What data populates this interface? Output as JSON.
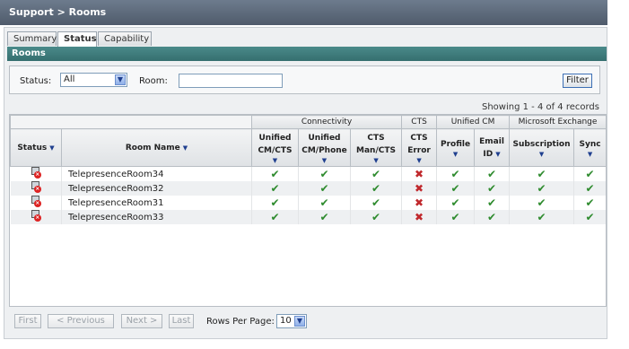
{
  "header": {
    "breadcrumb": "Support > Rooms"
  },
  "tabs": [
    {
      "label": "Summary",
      "active": false
    },
    {
      "label": "Status",
      "active": true
    },
    {
      "label": "Capability",
      "active": false
    }
  ],
  "section": {
    "title": "Rooms"
  },
  "filter": {
    "status_label": "Status:",
    "status_value": "All",
    "room_label": "Room:",
    "room_value": "",
    "button_label": "Filter"
  },
  "summary": {
    "showing": "Showing 1 - 4 of 4 records"
  },
  "table": {
    "groups": {
      "connectivity": "Connectivity",
      "cts": "CTS",
      "unified_cm": "Unified CM",
      "exchange": "Microsoft Exchange"
    },
    "columns": {
      "status": "Status",
      "room_name": "Room Name",
      "cm_cts_1": "Unified",
      "cm_cts_2": "CM/CTS",
      "cm_phone_1": "Unified",
      "cm_phone_2": "CM/Phone",
      "man_cts_1": "CTS",
      "man_cts_2": "Man/CTS",
      "cts_error_1": "CTS",
      "cts_error_2": "Error",
      "profile": "Profile",
      "email_1": "Email",
      "email_2": "ID",
      "subscription": "Subscription",
      "sync": "Sync"
    },
    "rows": [
      {
        "status_icon": "room-error-icon",
        "name": "TelepresenceRoom34",
        "cm_cts": "✔",
        "cm_phone": "✔",
        "man_cts": "✔",
        "cts_error": "✖",
        "profile": "✔",
        "email": "✔",
        "subscription": "✔",
        "sync": "✔"
      },
      {
        "status_icon": "room-error-icon",
        "name": "TelepresenceRoom32",
        "cm_cts": "✔",
        "cm_phone": "✔",
        "man_cts": "✔",
        "cts_error": "✖",
        "profile": "✔",
        "email": "✔",
        "subscription": "✔",
        "sync": "✔"
      },
      {
        "status_icon": "room-error-icon",
        "name": "TelepresenceRoom31",
        "cm_cts": "✔",
        "cm_phone": "✔",
        "man_cts": "✔",
        "cts_error": "✖",
        "profile": "✔",
        "email": "✔",
        "subscription": "✔",
        "sync": "✔"
      },
      {
        "status_icon": "room-error-icon",
        "name": "TelepresenceRoom33",
        "cm_cts": "✔",
        "cm_phone": "✔",
        "man_cts": "✔",
        "cts_error": "✖",
        "profile": "✔",
        "email": "✔",
        "subscription": "✔",
        "sync": "✔"
      }
    ]
  },
  "pager": {
    "first": "First",
    "previous": "< Previous",
    "next": "Next >",
    "last": "Last",
    "rows_per_page_label": "Rows Per Page:",
    "rows_per_page_value": "10"
  },
  "icons": {
    "sort": "sort-down-arrow-icon",
    "dropdown": "chevron-down-icon",
    "check": "check-icon",
    "cross": "cross-icon"
  },
  "colors": {
    "header_bar": "#5c6878",
    "section_bar": "#3f7d7d",
    "check": "#2e8b2e",
    "cross": "#c0282c"
  }
}
